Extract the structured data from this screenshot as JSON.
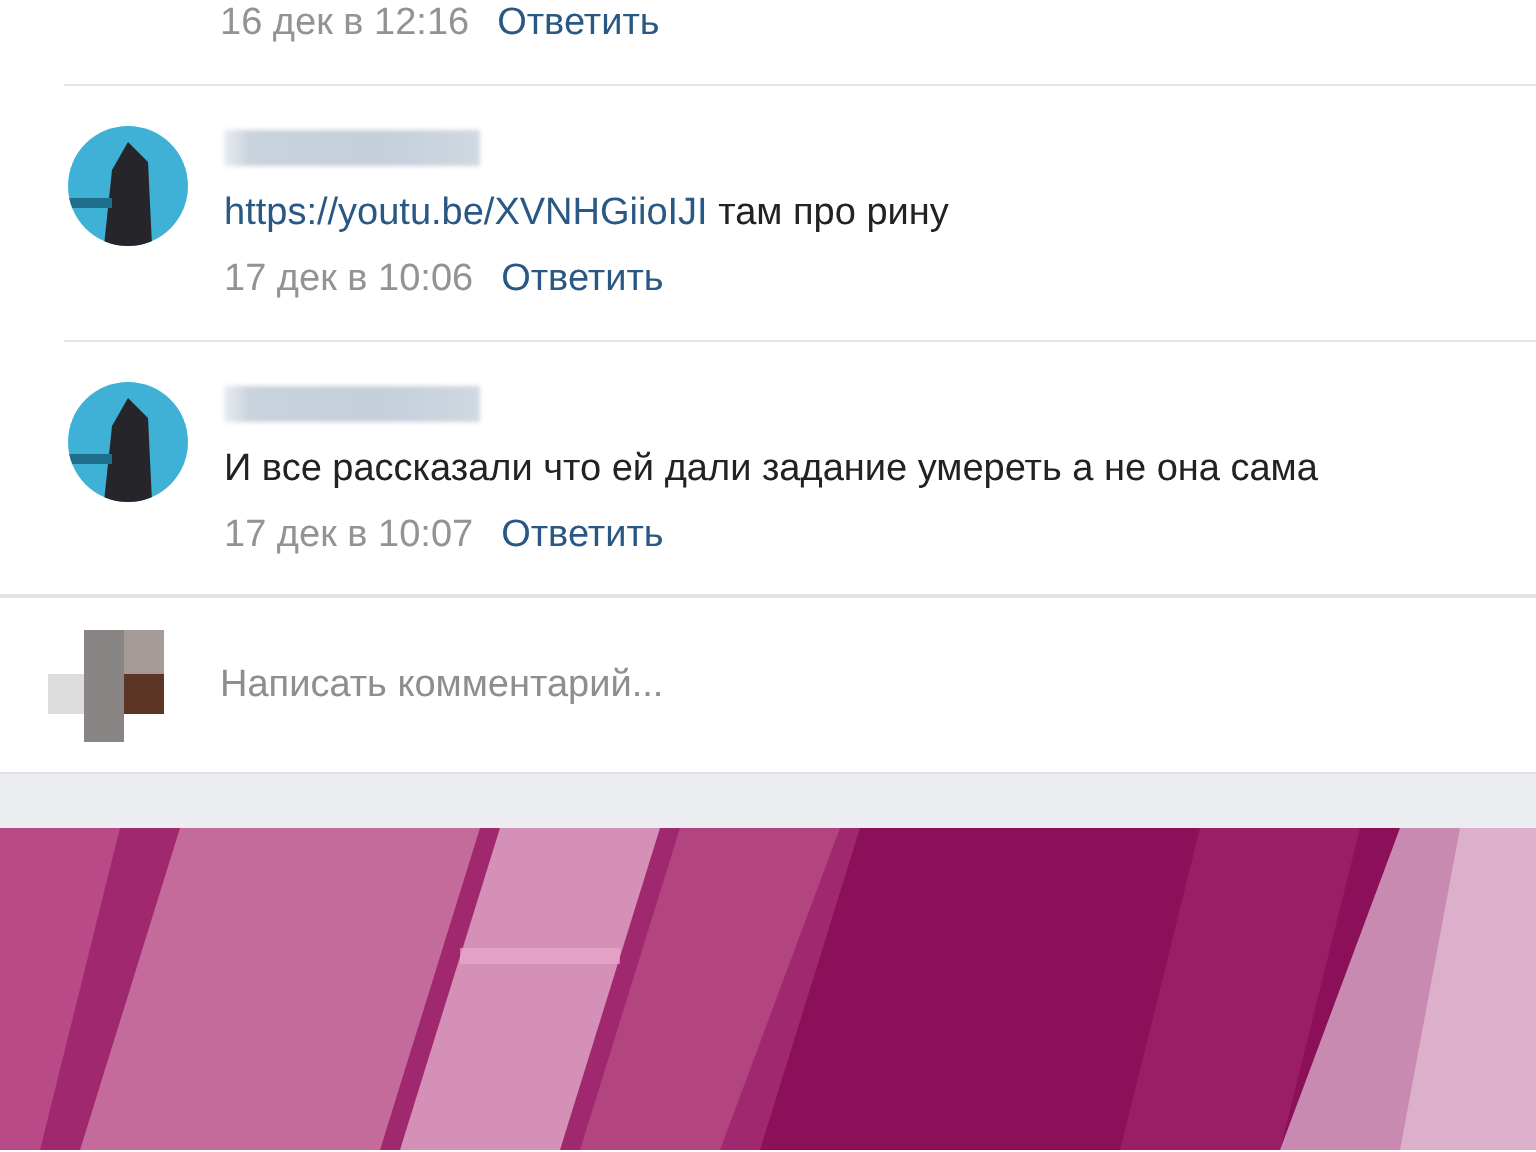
{
  "comments": [
    {
      "partial": true,
      "date": "16 дек в 12:16",
      "reply": "Ответить"
    },
    {
      "partial": false,
      "link": "https://youtu.be/XVNHGiioIJI",
      "text": " там про рину",
      "date": "17 дек в 10:06",
      "reply": "Ответить"
    },
    {
      "partial": false,
      "text": "И все рассказали что ей дали задание умереть а не она сама",
      "date": "17 дек в 10:07",
      "reply": "Ответить"
    }
  ],
  "compose": {
    "placeholder": "Написать комментарий..."
  }
}
